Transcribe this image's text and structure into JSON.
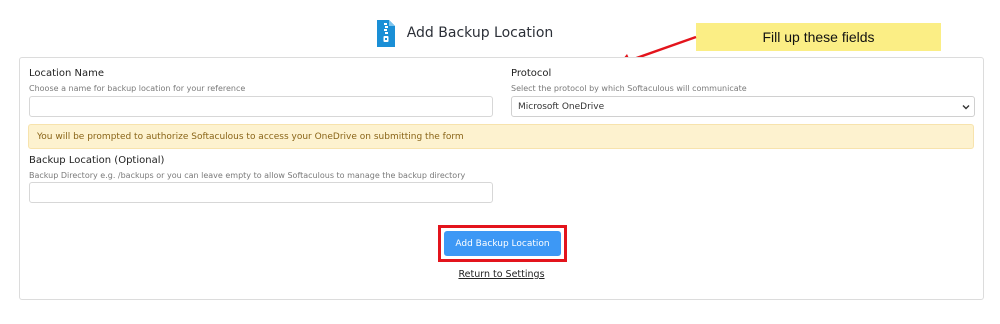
{
  "header": {
    "title": "Add Backup Location",
    "icon": "zip-file-icon"
  },
  "callout": {
    "text": "Fill up these fields"
  },
  "form": {
    "location_name": {
      "label": "Location Name",
      "help": "Choose a name for backup location for your reference",
      "value": "",
      "placeholder": ""
    },
    "protocol": {
      "label": "Protocol",
      "help": "Select the protocol by which Softaculous will communicate",
      "selected": "Microsoft OneDrive"
    },
    "notice": "You will be prompted to authorize Softaculous to access your OneDrive on submitting the form",
    "backup_location": {
      "label": "Backup Location (Optional)",
      "help": "Backup Directory e.g. /backups or you can leave empty to allow Softaculous to manage the backup directory",
      "value": "",
      "placeholder": ""
    },
    "submit_label": "Add Backup Location",
    "return_link": "Return to Settings"
  },
  "colors": {
    "primary_button": "#3d98f5",
    "highlight_box": "#e3141c",
    "callout_bg": "#fbee85",
    "notice_bg": "#fdf2cf",
    "notice_text": "#8a6518",
    "arrow": "#e3141c"
  }
}
